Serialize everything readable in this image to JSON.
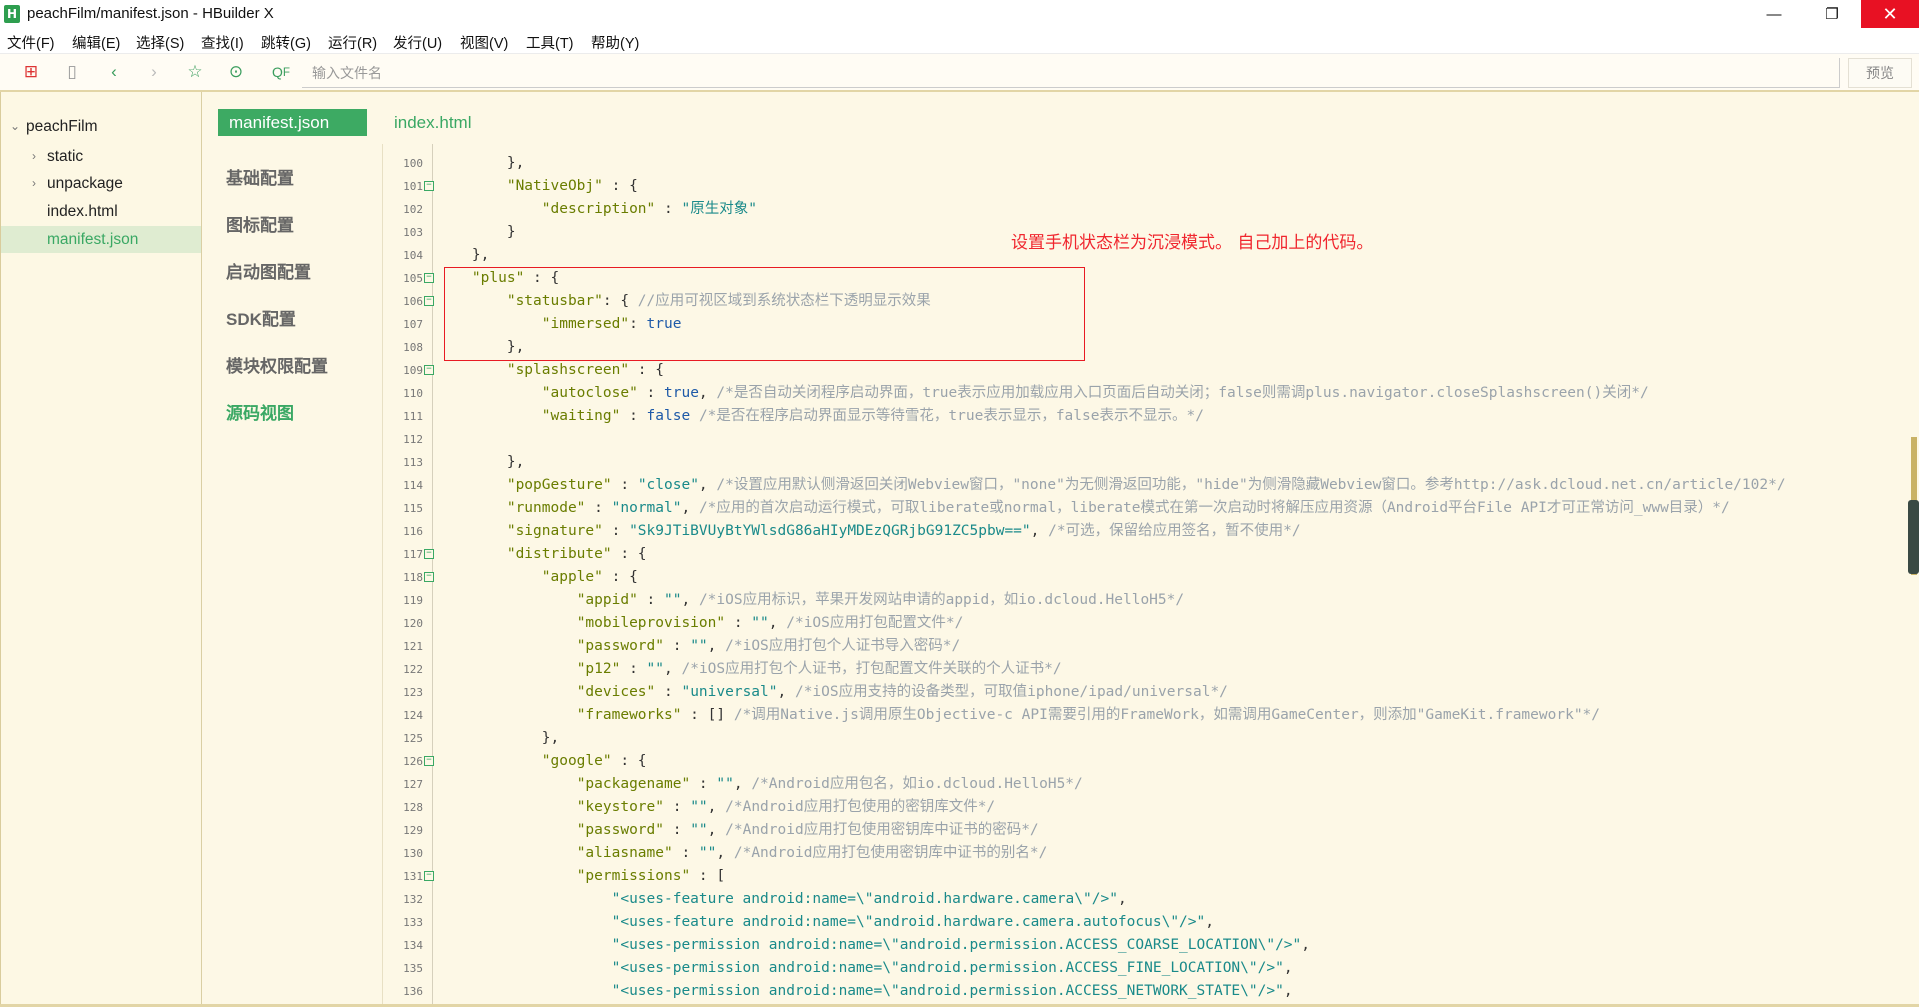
{
  "window": {
    "title": "peachFilm/manifest.json - HBuilder X",
    "app_icon": "H",
    "minimize": "—",
    "restore": "❐",
    "close": "✕"
  },
  "menu": [
    "文件(F)",
    "编辑(E)",
    "选择(S)",
    "查找(I)",
    "跳转(G)",
    "运行(R)",
    "发行(U)",
    "视图(V)",
    "工具(T)",
    "帮助(Y)"
  ],
  "toolbar": {
    "search_placeholder": "输入文件名",
    "preview": "预览",
    "icons": [
      "new-file-icon",
      "save-icon",
      "back-icon",
      "forward-icon",
      "star-icon",
      "run-icon",
      "search-file-icon"
    ]
  },
  "tree": {
    "root": "peachFilm",
    "items": [
      {
        "label": "static",
        "folder": true
      },
      {
        "label": "unpackage",
        "folder": true
      },
      {
        "label": "index.html",
        "folder": false
      },
      {
        "label": "manifest.json",
        "folder": false,
        "selected": true
      }
    ]
  },
  "tabs": {
    "active": "manifest.json",
    "other": "index.html"
  },
  "config_nav": [
    "基础配置",
    "图标配置",
    "启动图配置",
    "SDK配置",
    "模块权限配置",
    "源码视图"
  ],
  "annotation": "设置手机状态栏为沉浸模式。  自己加上的代码。",
  "code": [
    {
      "n": "100",
      "i": 2,
      "t": [
        [
          "p",
          "},"
        ]
      ]
    },
    {
      "n": "101",
      "i": 2,
      "f": true,
      "t": [
        [
          "k",
          "\"NativeObj\""
        ],
        [
          "p",
          " : {"
        ]
      ]
    },
    {
      "n": "102",
      "i": 3,
      "t": [
        [
          "k",
          "\"description\""
        ],
        [
          "p",
          " : "
        ],
        [
          "s",
          "\"原生对象\""
        ]
      ]
    },
    {
      "n": "103",
      "i": 2,
      "t": [
        [
          "p",
          "}"
        ]
      ]
    },
    {
      "n": "104",
      "i": 1,
      "t": [
        [
          "p",
          "},"
        ]
      ]
    },
    {
      "n": "105",
      "i": 1,
      "f": true,
      "t": [
        [
          "k",
          "\"plus\""
        ],
        [
          "p",
          " : {"
        ]
      ]
    },
    {
      "n": "106",
      "i": 2,
      "f": true,
      "t": [
        [
          "k",
          "\"statusbar\""
        ],
        [
          "p",
          ": { "
        ],
        [
          "c",
          "//应用可视区域到系统状态栏下透明显示效果"
        ]
      ]
    },
    {
      "n": "107",
      "i": 3,
      "t": [
        [
          "k",
          "\"immersed\""
        ],
        [
          "p",
          ": "
        ],
        [
          "b",
          "true"
        ]
      ]
    },
    {
      "n": "108",
      "i": 2,
      "t": [
        [
          "p",
          "},"
        ]
      ]
    },
    {
      "n": "109",
      "i": 2,
      "f": true,
      "t": [
        [
          "k",
          "\"splashscreen\""
        ],
        [
          "p",
          " : {"
        ]
      ]
    },
    {
      "n": "110",
      "i": 3,
      "t": [
        [
          "k",
          "\"autoclose\""
        ],
        [
          "p",
          " : "
        ],
        [
          "b",
          "true"
        ],
        [
          "p",
          ", "
        ],
        [
          "c",
          "/*是否自动关闭程序启动界面，true表示应用加载应用入口页面后自动关闭；false则需调plus.navigator.closeSplashscreen()关闭*/"
        ]
      ]
    },
    {
      "n": "111",
      "i": 3,
      "t": [
        [
          "k",
          "\"waiting\""
        ],
        [
          "p",
          " : "
        ],
        [
          "b",
          "false"
        ],
        [
          "p",
          " "
        ],
        [
          "c",
          "/*是否在程序启动界面显示等待雪花，true表示显示，false表示不显示。*/"
        ]
      ]
    },
    {
      "n": "112",
      "i": 0,
      "t": []
    },
    {
      "n": "113",
      "i": 2,
      "t": [
        [
          "p",
          "},"
        ]
      ]
    },
    {
      "n": "114",
      "i": 2,
      "t": [
        [
          "k",
          "\"popGesture\""
        ],
        [
          "p",
          " : "
        ],
        [
          "s",
          "\"close\""
        ],
        [
          "p",
          ", "
        ],
        [
          "c",
          "/*设置应用默认侧滑返回关闭Webview窗口，\"none\"为无侧滑返回功能，\"hide\"为侧滑隐藏Webview窗口。参考http://ask.dcloud.net.cn/article/102*/"
        ]
      ]
    },
    {
      "n": "115",
      "i": 2,
      "t": [
        [
          "k",
          "\"runmode\""
        ],
        [
          "p",
          " : "
        ],
        [
          "s",
          "\"normal\""
        ],
        [
          "p",
          ", "
        ],
        [
          "c",
          "/*应用的首次启动运行模式，可取liberate或normal，liberate模式在第一次启动时将解压应用资源（Android平台File API才可正常访问_www目录）*/"
        ]
      ]
    },
    {
      "n": "116",
      "i": 2,
      "t": [
        [
          "k",
          "\"signature\""
        ],
        [
          "p",
          " : "
        ],
        [
          "s",
          "\"Sk9JTiBVUyBtYWlsdG86aHIyMDEzQGRjbG91ZC5pbw==\""
        ],
        [
          "p",
          ", "
        ],
        [
          "c",
          "/*可选，保留给应用签名，暂不使用*/"
        ]
      ]
    },
    {
      "n": "117",
      "i": 2,
      "f": true,
      "t": [
        [
          "k",
          "\"distribute\""
        ],
        [
          "p",
          " : {"
        ]
      ]
    },
    {
      "n": "118",
      "i": 3,
      "f": true,
      "t": [
        [
          "k",
          "\"apple\""
        ],
        [
          "p",
          " : {"
        ]
      ]
    },
    {
      "n": "119",
      "i": 4,
      "t": [
        [
          "k",
          "\"appid\""
        ],
        [
          "p",
          " : "
        ],
        [
          "s",
          "\"\""
        ],
        [
          "p",
          ", "
        ],
        [
          "c",
          "/*iOS应用标识，苹果开发网站申请的appid，如io.dcloud.HelloH5*/"
        ]
      ]
    },
    {
      "n": "120",
      "i": 4,
      "t": [
        [
          "k",
          "\"mobileprovision\""
        ],
        [
          "p",
          " : "
        ],
        [
          "s",
          "\"\""
        ],
        [
          "p",
          ", "
        ],
        [
          "c",
          "/*iOS应用打包配置文件*/"
        ]
      ]
    },
    {
      "n": "121",
      "i": 4,
      "t": [
        [
          "k",
          "\"password\""
        ],
        [
          "p",
          " : "
        ],
        [
          "s",
          "\"\""
        ],
        [
          "p",
          ", "
        ],
        [
          "c",
          "/*iOS应用打包个人证书导入密码*/"
        ]
      ]
    },
    {
      "n": "122",
      "i": 4,
      "t": [
        [
          "k",
          "\"p12\""
        ],
        [
          "p",
          " : "
        ],
        [
          "s",
          "\"\""
        ],
        [
          "p",
          ", "
        ],
        [
          "c",
          "/*iOS应用打包个人证书，打包配置文件关联的个人证书*/"
        ]
      ]
    },
    {
      "n": "123",
      "i": 4,
      "t": [
        [
          "k",
          "\"devices\""
        ],
        [
          "p",
          " : "
        ],
        [
          "s",
          "\"universal\""
        ],
        [
          "p",
          ", "
        ],
        [
          "c",
          "/*iOS应用支持的设备类型，可取值iphone/ipad/universal*/"
        ]
      ]
    },
    {
      "n": "124",
      "i": 4,
      "t": [
        [
          "k",
          "\"frameworks\""
        ],
        [
          "p",
          " : [] "
        ],
        [
          "c",
          "/*调用Native.js调用原生Objective-c API需要引用的FrameWork，如需调用GameCenter，则添加\"GameKit.framework\"*/"
        ]
      ]
    },
    {
      "n": "125",
      "i": 3,
      "t": [
        [
          "p",
          "},"
        ]
      ]
    },
    {
      "n": "126",
      "i": 3,
      "f": true,
      "t": [
        [
          "k",
          "\"google\""
        ],
        [
          "p",
          " : {"
        ]
      ]
    },
    {
      "n": "127",
      "i": 4,
      "t": [
        [
          "k",
          "\"packagename\""
        ],
        [
          "p",
          " : "
        ],
        [
          "s",
          "\"\""
        ],
        [
          "p",
          ", "
        ],
        [
          "c",
          "/*Android应用包名，如io.dcloud.HelloH5*/"
        ]
      ]
    },
    {
      "n": "128",
      "i": 4,
      "t": [
        [
          "k",
          "\"keystore\""
        ],
        [
          "p",
          " : "
        ],
        [
          "s",
          "\"\""
        ],
        [
          "p",
          ", "
        ],
        [
          "c",
          "/*Android应用打包使用的密钥库文件*/"
        ]
      ]
    },
    {
      "n": "129",
      "i": 4,
      "t": [
        [
          "k",
          "\"password\""
        ],
        [
          "p",
          " : "
        ],
        [
          "s",
          "\"\""
        ],
        [
          "p",
          ", "
        ],
        [
          "c",
          "/*Android应用打包使用密钥库中证书的密码*/"
        ]
      ]
    },
    {
      "n": "130",
      "i": 4,
      "t": [
        [
          "k",
          "\"aliasname\""
        ],
        [
          "p",
          " : "
        ],
        [
          "s",
          "\"\""
        ],
        [
          "p",
          ", "
        ],
        [
          "c",
          "/*Android应用打包使用密钥库中证书的别名*/"
        ]
      ]
    },
    {
      "n": "131",
      "i": 4,
      "f": true,
      "t": [
        [
          "k",
          "\"permissions\""
        ],
        [
          "p",
          " : ["
        ]
      ]
    },
    {
      "n": "132",
      "i": 5,
      "t": [
        [
          "s",
          "\"<uses-feature android:name=\\\"android.hardware.camera\\\"/>\""
        ],
        [
          "p",
          ","
        ]
      ]
    },
    {
      "n": "133",
      "i": 5,
      "t": [
        [
          "s",
          "\"<uses-feature android:name=\\\"android.hardware.camera.autofocus\\\"/>\""
        ],
        [
          "p",
          ","
        ]
      ]
    },
    {
      "n": "134",
      "i": 5,
      "t": [
        [
          "s",
          "\"<uses-permission android:name=\\\"android.permission.ACCESS_COARSE_LOCATION\\\"/>\""
        ],
        [
          "p",
          ","
        ]
      ]
    },
    {
      "n": "135",
      "i": 5,
      "t": [
        [
          "s",
          "\"<uses-permission android:name=\\\"android.permission.ACCESS_FINE_LOCATION\\\"/>\""
        ],
        [
          "p",
          ","
        ]
      ]
    },
    {
      "n": "136",
      "i": 5,
      "t": [
        [
          "s",
          "\"<uses-permission android:name=\\\"android.permission.ACCESS_NETWORK_STATE\\\"/>\""
        ],
        [
          "p",
          ","
        ]
      ]
    }
  ],
  "colors": {
    "accent": "#3daa63",
    "key": "#6a7d00",
    "string": "#1a8a8a",
    "comment": "#9aa3ab",
    "bool": "#1e5aa8",
    "annotation": "#f0262e"
  }
}
